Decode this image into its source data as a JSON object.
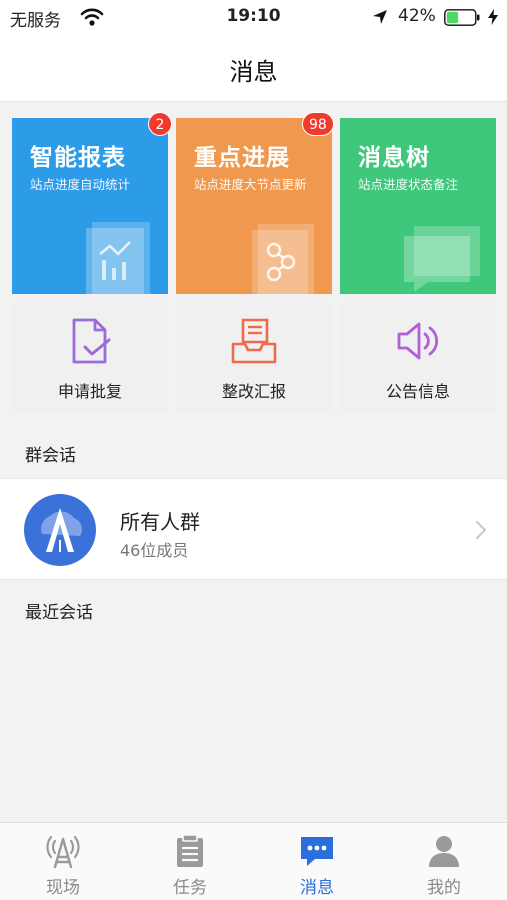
{
  "status_bar": {
    "carrier": "无服务",
    "time": "19:10",
    "battery_percent": "42%",
    "battery_level": 0.42,
    "battery_color": "#4cd964"
  },
  "nav": {
    "title": "消息"
  },
  "tiles": [
    {
      "title": "智能报表",
      "subtitle": "站点进度自动统计",
      "badge": "2",
      "color": "#2c9ce8",
      "icon": "chart-icon"
    },
    {
      "title": "重点进展",
      "subtitle": "站点进度大节点更新",
      "badge": "98",
      "color": "#f0984e",
      "icon": "flow-node-icon"
    },
    {
      "title": "消息树",
      "subtitle": "站点进度状态备注",
      "color": "#3fc77b",
      "icon": "chat-bubble-icon"
    }
  ],
  "actions": [
    {
      "label": "申请批复",
      "icon": "document-check-icon",
      "color": "#9b6bd9"
    },
    {
      "label": "整改汇报",
      "icon": "report-tray-icon",
      "color": "#f06a4e"
    },
    {
      "label": "公告信息",
      "icon": "speaker-icon",
      "color": "#b05fd6"
    }
  ],
  "sections": {
    "group_header": "群会话",
    "recent_header": "最近会话"
  },
  "group": {
    "name": "所有人群",
    "members": "46位成员",
    "avatar_color": "#3b72d9",
    "icon": "road-tower-avatar-icon"
  },
  "tabs": [
    {
      "label": "现场",
      "icon": "tower-icon",
      "active": false
    },
    {
      "label": "任务",
      "icon": "clipboard-icon",
      "active": false
    },
    {
      "label": "消息",
      "icon": "message-icon",
      "active": true
    },
    {
      "label": "我的",
      "icon": "person-icon",
      "active": false
    }
  ],
  "accent_color": "#2a6fdb"
}
